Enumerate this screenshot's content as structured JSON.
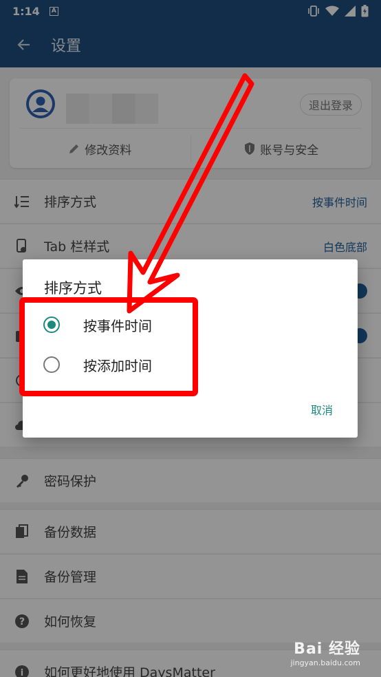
{
  "status_bar": {
    "time": "1:14",
    "a_badge": "A"
  },
  "app_bar": {
    "title": "设置"
  },
  "account": {
    "logout_label": "退出登录",
    "edit_profile": "修改资料",
    "security": "账号与安全"
  },
  "settings": {
    "sort_label": "排序方式",
    "sort_value": "按事件时间",
    "tab_style_label": "Tab 栏样式",
    "tab_style_value": "白色底部",
    "password_label": "密码保护",
    "backup_label": "备份数据",
    "backup_manage_label": "备份管理",
    "restore_label": "如何恢复",
    "howto_label": "如何更好地使用 DaysMatter"
  },
  "dialog": {
    "title": "排序方式",
    "options": [
      {
        "label": "按事件时间",
        "selected": true
      },
      {
        "label": "按添加时间",
        "selected": false
      }
    ],
    "cancel_label": "取消"
  },
  "watermark": {
    "brand": "Bai  经验",
    "url": "jingyan.baidu.com"
  },
  "colors": {
    "primary": "#1f4f7e",
    "accent": "#1e8a7e",
    "link": "#1f5f9a",
    "annotation": "#ff0000"
  }
}
